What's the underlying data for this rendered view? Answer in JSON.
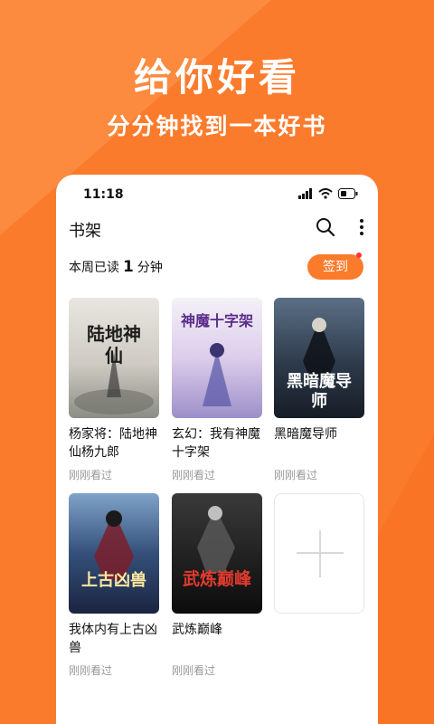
{
  "promo": {
    "title": "给你好看",
    "subtitle": "分分钟找到一本好书"
  },
  "status_bar": {
    "time": "11:18"
  },
  "app": {
    "title": "书架",
    "icons": [
      "search-icon",
      "more-icon"
    ]
  },
  "reading": {
    "prefix": "本周已读",
    "minutes": "1",
    "suffix": "分钟",
    "checkin_label": "签到"
  },
  "books": [
    {
      "title": "杨家将：陆地神仙杨九郎",
      "status": "刚刚看过",
      "cover_text": "陆地神仙"
    },
    {
      "title": "玄幻：我有神魔十字架",
      "status": "刚刚看过",
      "cover_text": "神魔十字架"
    },
    {
      "title": "黑暗魔导师",
      "status": "刚刚看过",
      "cover_text": "黑暗魔导师"
    },
    {
      "title": "我体内有上古凶兽",
      "status": "刚刚看过",
      "cover_text": "上古凶兽"
    },
    {
      "title": "武炼巅峰",
      "status": "刚刚看过",
      "cover_text": "武炼巅峰"
    }
  ],
  "colors": {
    "accent": "#FB7B2C",
    "badge": "#FF3333"
  }
}
